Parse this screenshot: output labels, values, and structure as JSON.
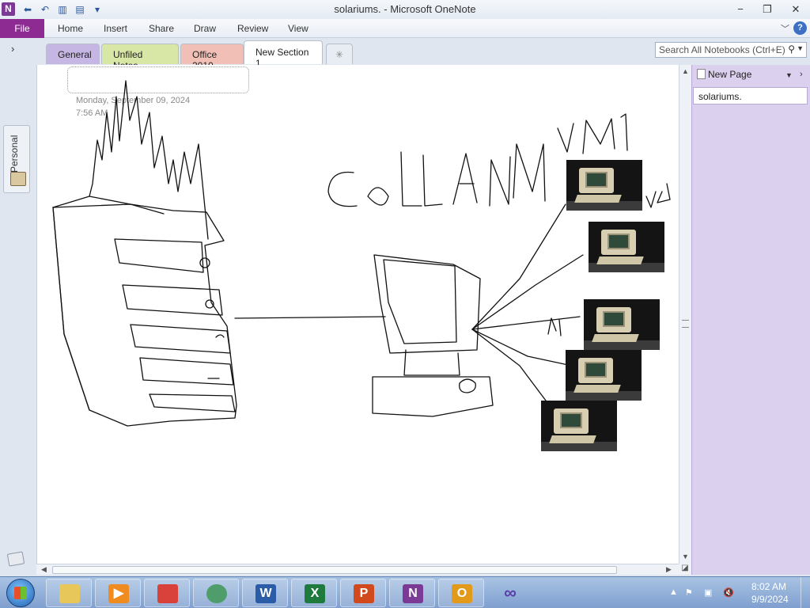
{
  "window": {
    "app_logo": "N",
    "title": "solariums.  -  Microsoft OneNote",
    "controls": {
      "minimize": "−",
      "restore": "❐",
      "close": "✕"
    }
  },
  "ribbon": {
    "file": "File",
    "tabs": [
      "Home",
      "Insert",
      "Share",
      "Draw",
      "Review",
      "View"
    ],
    "help": "?"
  },
  "sections": {
    "tabs": [
      "General",
      "Unfiled Notes",
      "Office 2010",
      "New Section 1"
    ],
    "active": "New Section 1",
    "new_section_symbol": "✳"
  },
  "search": {
    "placeholder": "Search All Notebooks (Ctrl+E)"
  },
  "notebook": {
    "name": "Personal"
  },
  "page": {
    "date": "Monday, September  09, 2024",
    "time": "7:56 AM",
    "image_count": 5
  },
  "pages_pane": {
    "new_page": "New Page",
    "items": [
      "solariums."
    ]
  },
  "taskbar": {
    "apps": [
      {
        "name": "Windows Explorer",
        "icon": "folder-icon",
        "glyph": "",
        "color": "#e7c75a"
      },
      {
        "name": "Media Player",
        "icon": "media-player-icon",
        "glyph": "▶",
        "color": "#f08c1f"
      },
      {
        "name": "GeoGebra",
        "icon": "gift-box-icon",
        "glyph": "",
        "color": "#d8423a"
      },
      {
        "name": "Browser",
        "icon": "browser-icon",
        "glyph": "",
        "color": "#4e9d6a"
      },
      {
        "name": "Word",
        "icon": "word-icon",
        "glyph": "W",
        "color": "#2b5ca8"
      },
      {
        "name": "Excel",
        "icon": "excel-icon",
        "glyph": "X",
        "color": "#1f7a3d"
      },
      {
        "name": "PowerPoint",
        "icon": "powerpoint-icon",
        "glyph": "P",
        "color": "#d04a1e"
      },
      {
        "name": "OneNote",
        "icon": "onenote-icon",
        "glyph": "N",
        "color": "#7b3a96"
      },
      {
        "name": "Outlook",
        "icon": "outlook-icon",
        "glyph": "O",
        "color": "#e39a1a"
      },
      {
        "name": "Visual Studio",
        "icon": "infinity-icon",
        "glyph": "∞",
        "color": "#6a4fb0"
      }
    ],
    "clock_time": "8:02 AM",
    "clock_date": "9/9/2024"
  }
}
